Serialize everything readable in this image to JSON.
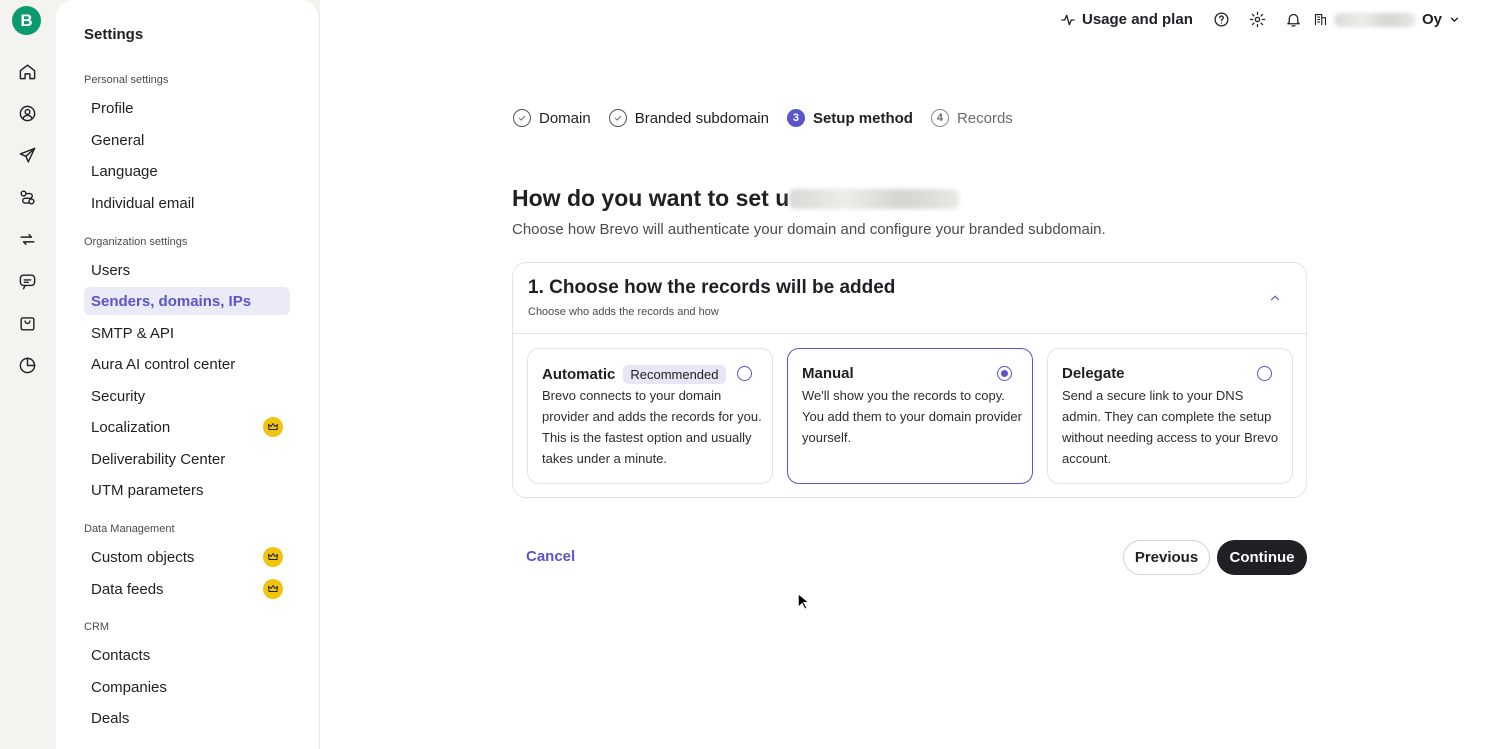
{
  "app": {
    "logo_letter": "B"
  },
  "rail": {
    "icons": [
      "home-icon",
      "contacts-icon",
      "campaigns-icon",
      "automations-icon",
      "sync-icon",
      "conversations-icon",
      "commerce-icon",
      "reports-icon"
    ]
  },
  "sidebar": {
    "title": "Settings",
    "personal_label": "Personal settings",
    "personal": [
      "Profile",
      "General",
      "Language",
      "Individual email"
    ],
    "org_label": "Organization settings",
    "org": [
      "Users",
      "Senders, domains, IPs",
      "SMTP & API",
      "Aura AI control center",
      "Security",
      "Localization",
      "Deliverability Center",
      "UTM parameters"
    ],
    "data_label": "Data Management",
    "data": [
      "Custom objects",
      "Data feeds"
    ],
    "crm_label": "CRM",
    "crm": [
      "Contacts",
      "Companies",
      "Deals"
    ],
    "active_item": "Senders, domains, IPs"
  },
  "topbar": {
    "usage_label": "Usage and plan",
    "org_suffix": "Oy"
  },
  "stepper": {
    "steps": [
      "Domain",
      "Branded subdomain",
      "Setup method",
      "Records"
    ],
    "current_number": "3",
    "pending_number": "4"
  },
  "main": {
    "heading": "How do you want to set u",
    "subheading": "Choose how Brevo will authenticate your domain and configure your branded subdomain."
  },
  "card": {
    "title": "1. Choose how the records will be added",
    "subtitle": "Choose who adds the records and how",
    "options": [
      {
        "title": "Automatic",
        "badge": "Recommended",
        "desc": "Brevo connects to your domain provider and adds the records for you. This is the fastest option and usually takes under a minute.",
        "selected": false
      },
      {
        "title": "Manual",
        "desc": "We'll show you the records to copy. You add them to your domain provider yourself.",
        "selected": true
      },
      {
        "title": "Delegate",
        "desc": "Send a secure link to your DNS admin. They can complete the setup without needing access to your Brevo account.",
        "selected": false
      }
    ]
  },
  "actions": {
    "cancel": "Cancel",
    "previous": "Previous",
    "continue": "Continue"
  },
  "colors": {
    "accent": "#5a56c7",
    "brand": "#0b996e",
    "premium": "#f1c40f"
  }
}
